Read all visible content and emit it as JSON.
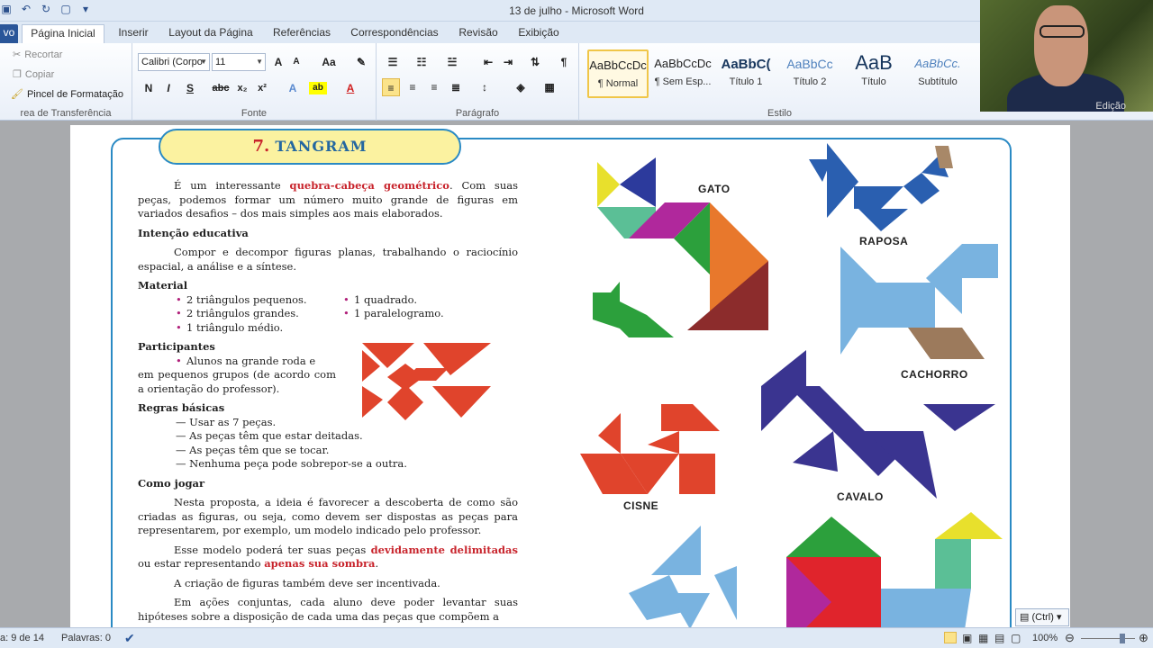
{
  "window": {
    "title": "13 de julho - Microsoft Word"
  },
  "tabs": {
    "file": "vo",
    "items": [
      "Página Inicial",
      "Inserir",
      "Layout da Página",
      "Referências",
      "Correspondências",
      "Revisão",
      "Exibição"
    ]
  },
  "clipboard": {
    "cut": "Recortar",
    "copy": "Copiar",
    "painter": "Pincel de Formatação",
    "label": "rea de Transferência"
  },
  "font": {
    "name": "Calibri (Corpo",
    "size": "11",
    "label": "Fonte"
  },
  "paragraph": {
    "label": "Parágrafo"
  },
  "styles": {
    "label": "Estilo",
    "items": [
      {
        "sample": "AaBbCcDc",
        "name": "¶ Normal"
      },
      {
        "sample": "AaBbCcDc",
        "name": "¶ Sem Esp..."
      },
      {
        "sample": "AaBbC(",
        "name": "Título 1"
      },
      {
        "sample": "AaBbCc",
        "name": "Título 2"
      },
      {
        "sample": "AaB",
        "name": "Título"
      },
      {
        "sample": "AaBbCc.",
        "name": "Subtítulo"
      }
    ]
  },
  "editing": {
    "label": "Edição"
  },
  "doc": {
    "number": "7.",
    "title": "TANGRAM",
    "intro_a": "É um interessante ",
    "intro_red": "quebra-cabeça geométrico",
    "intro_b": ". Com suas peças, podemos formar um número muito grande de figuras em variados desafios – dos mais simples aos mais elaborados.",
    "h_intencao": "Intenção educativa",
    "intencao": "Compor e decompor figuras planas, trabalhando o raciocínio espacial, a análise e a síntese.",
    "h_material": "Material",
    "material_left": [
      "2 triângulos pequenos.",
      "2 triângulos grandes.",
      "1 triângulo médio."
    ],
    "material_right": [
      "1 quadrado.",
      "1 paralelogramo."
    ],
    "h_participantes": "Participantes",
    "participantes_a": "Alunos na grande roda e",
    "participantes_b": "em pequenos grupos (de acordo com a orientação do professor).",
    "h_regras": "Regras básicas",
    "regras": [
      "— Usar as 7 peças.",
      "— As peças têm que estar deitadas.",
      "— As peças têm que se tocar.",
      "— Nenhuma peça pode sobrepor-se a outra."
    ],
    "h_jogar": "Como jogar",
    "jogar1": "Nesta proposta, a ideia é favorecer a descoberta de como são criadas as figuras, ou seja, como devem ser dispostas as peças para representarem, por exemplo, um modelo indicado pelo professor.",
    "jogar2_a": "Esse modelo poderá ter suas peças ",
    "jogar2_red1": "devidamente delimitadas",
    "jogar2_b": " ou estar representando ",
    "jogar2_red2": "apenas sua sombra",
    "jogar2_c": ".",
    "jogar3": "A criação de figuras também deve ser incentivada.",
    "jogar4": "Em ações conjuntas, cada aluno deve poder levantar suas hipóteses sobre a disposição de cada uma das peças que compõem a",
    "labels": {
      "gato": "GATO",
      "raposa": "RAPOSA",
      "cachorro": "CACHORRO",
      "cavalo": "CAVALO",
      "cisne": "CISNE"
    }
  },
  "status": {
    "page": "a: 9 de 14",
    "words": "Palavras: 0",
    "zoom": "100%"
  },
  "paste_ctrl": "(Ctrl) ▾",
  "colors": {
    "accent": "#2a8ac4",
    "red": "#c8242c",
    "ribbon": "#dfe9f5"
  }
}
